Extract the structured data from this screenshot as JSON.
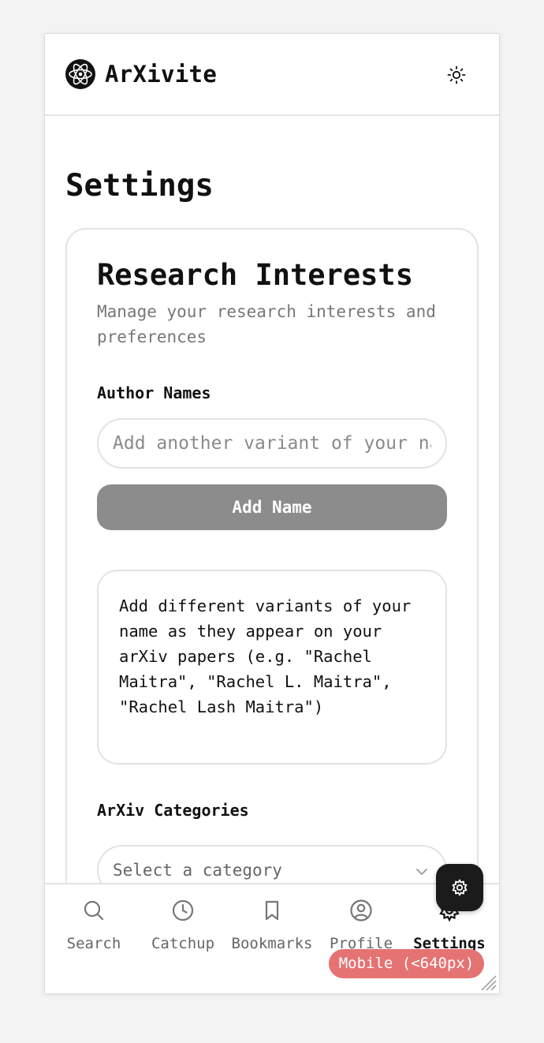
{
  "app": {
    "name": "ArXivite"
  },
  "page": {
    "title": "Settings"
  },
  "research_card": {
    "title": "Research Interests",
    "subtitle": "Manage your research interests and preferences"
  },
  "author_names": {
    "label": "Author Names",
    "input_placeholder": "Add another variant of your name",
    "input_value": "",
    "add_button_label": "Add Name",
    "hint": "Add different variants of your name as they appear on your arXiv papers (e.g. \"Rachel Maitra\", \"Rachel L. Maitra\", \"Rachel Lash Maitra\")"
  },
  "categories": {
    "label": "ArXiv Categories",
    "select_placeholder": "Select a category"
  },
  "bottom_nav": {
    "items": [
      {
        "label": "Search",
        "icon": "search-icon"
      },
      {
        "label": "Catchup",
        "icon": "clock-icon"
      },
      {
        "label": "Bookmarks",
        "icon": "bookmark-icon"
      },
      {
        "label": "Profile",
        "icon": "user-circle-icon"
      },
      {
        "label": "Settings",
        "icon": "gear-icon",
        "active": true
      }
    ]
  },
  "debug": {
    "breakpoint_badge": "Mobile (<640px)"
  },
  "colors": {
    "accent_button": "#8c8c8c",
    "badge": "#e57373",
    "fab": "#1b1b1b"
  }
}
